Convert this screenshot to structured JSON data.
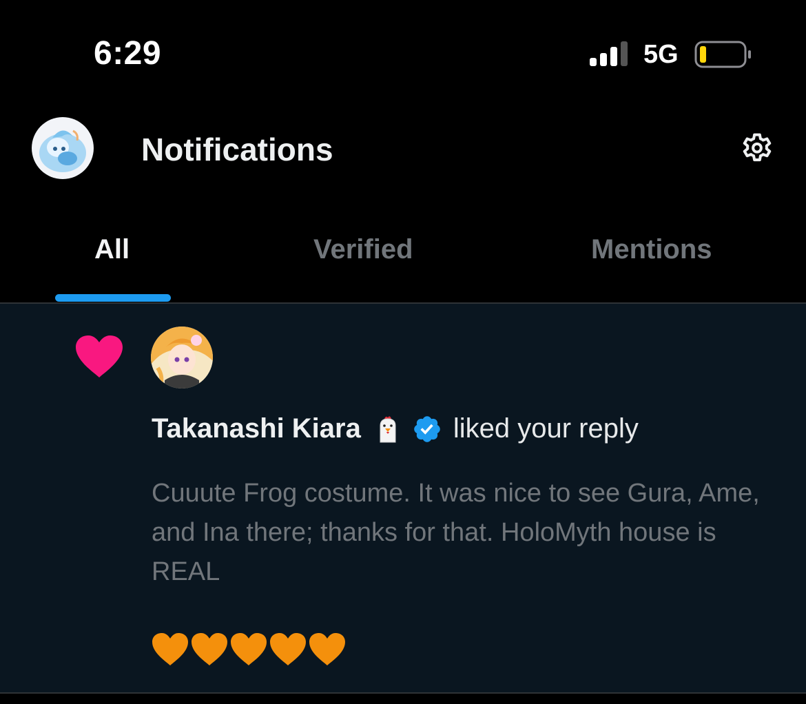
{
  "status_bar": {
    "time": "6:29",
    "network": "5G",
    "battery_level": 0.1
  },
  "header": {
    "title": "Notifications",
    "settings_icon": "gear-icon"
  },
  "tabs": [
    {
      "label": "All",
      "active": true
    },
    {
      "label": "Verified",
      "active": false
    },
    {
      "label": "Mentions",
      "active": false
    }
  ],
  "notification": {
    "type_icon": "heart-icon",
    "user_name": "Takanashi Kiara",
    "action_text": "liked your reply",
    "reply_text": "Cuuute Frog costume. It was nice to see Gura, Ame, and Ina there; thanks for that. HoloMyth house is REAL",
    "emoji_hearts": [
      "orange-heart",
      "orange-heart",
      "orange-heart",
      "orange-heart",
      "orange-heart"
    ]
  },
  "colors": {
    "background": "#000000",
    "notification_bg": "#0a1620",
    "accent": "#1d9bf0",
    "like": "#f91880",
    "orange_heart": "#f4900c",
    "muted_text": "#71767b",
    "battery_low": "#ffd60a"
  }
}
